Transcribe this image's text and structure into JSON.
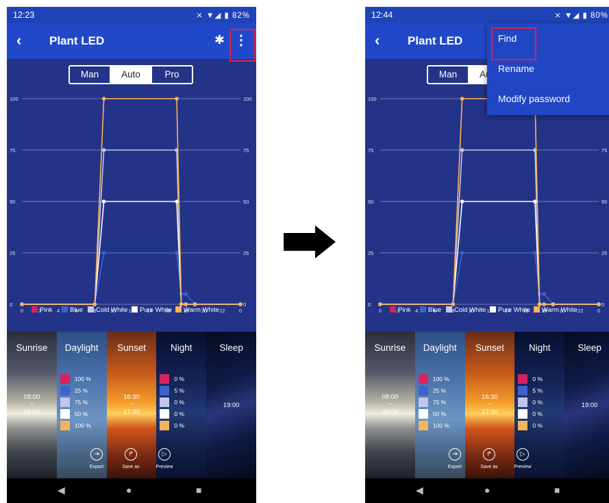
{
  "left": {
    "status_time": "12:23",
    "status_icons": "⨯ ▼◢ ▮ 82%",
    "battery": "82%"
  },
  "right": {
    "status_time": "12:44",
    "status_icons": "⨯ ▼◢ ▮ 80%",
    "battery": "80%",
    "menu": [
      "Find",
      "Rename",
      "Modify password"
    ]
  },
  "appbar": {
    "back": "‹",
    "title": "Plant LED",
    "bluetooth": "✱",
    "menu": "⋮"
  },
  "modes": [
    "Man",
    "Auto",
    "Pro"
  ],
  "active_mode": "Auto",
  "chart_data": {
    "type": "line",
    "x": [
      0,
      8,
      9,
      17,
      17.5,
      18,
      19,
      24
    ],
    "xticks": [
      0,
      2,
      4,
      6,
      8,
      10,
      12,
      14,
      16,
      18,
      20,
      22,
      0
    ],
    "yticks": [
      0,
      25,
      50,
      75,
      100
    ],
    "ylim": [
      0,
      100
    ],
    "xlim": [
      0,
      24
    ],
    "grid": true,
    "legend_position": "bottom",
    "series": [
      {
        "name": "Pink",
        "color": "#d6225f",
        "values": [
          0,
          0,
          100,
          100,
          0,
          0,
          0,
          0
        ]
      },
      {
        "name": "Blue",
        "color": "#3d63c9",
        "values": [
          0,
          0,
          25,
          25,
          5,
          5,
          0,
          0
        ]
      },
      {
        "name": "Cold White",
        "color": "#c3c6ea",
        "values": [
          0,
          0,
          75,
          75,
          0,
          0,
          0,
          0
        ]
      },
      {
        "name": "Pure White",
        "color": "#ffffff",
        "values": [
          0,
          0,
          50,
          50,
          0,
          0,
          0,
          0
        ]
      },
      {
        "name": "Warm White",
        "color": "#f5b45a",
        "values": [
          0,
          0,
          100,
          100,
          0,
          0,
          0,
          0
        ]
      }
    ]
  },
  "scenes": [
    {
      "name": "Sunrise",
      "time_start": "08:00",
      "time_sep": "~",
      "time_end": "09:00"
    },
    {
      "name": "Daylight",
      "levels": [
        "100 %",
        "25 %",
        "75 %",
        "50 %",
        "100 %"
      ]
    },
    {
      "name": "Sunset",
      "time_start": "16:30",
      "time_sep": "~",
      "time_end": "17:30"
    },
    {
      "name": "Night",
      "levels": [
        "0 %",
        "5 %",
        "0 %",
        "0 %",
        "0 %"
      ]
    },
    {
      "name": "Sleep",
      "time_start": "19:00"
    }
  ],
  "level_colors": [
    "#d6225f",
    "#3d63c9",
    "#c3c6ea",
    "#ffffff",
    "#f5b45a"
  ],
  "actions": [
    "Export",
    "Save as",
    "Preview"
  ],
  "nav": {
    "back": "◀",
    "home": "●",
    "recent": "■"
  },
  "colors": {
    "accent": "#2148c8",
    "background": "#233488",
    "highlight": "#e0204b"
  }
}
